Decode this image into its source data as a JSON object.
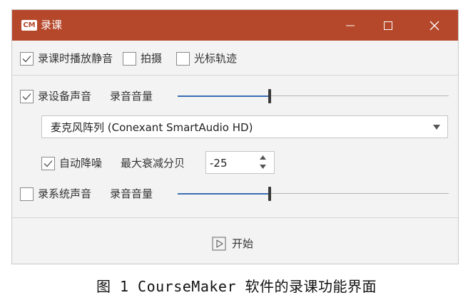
{
  "window": {
    "title": "录课",
    "logo_text": "CM",
    "accent_color": "#b5472a",
    "controls": [
      "minimize-icon",
      "maximize-icon",
      "close-icon"
    ]
  },
  "options": {
    "mute_playback": {
      "label": "录课时播放静音",
      "checked": true
    },
    "capture": {
      "label": "拍摄",
      "checked": false
    },
    "cursor_trail": {
      "label": "光标轨迹",
      "checked": false
    }
  },
  "device_audio": {
    "label": "录设备声音",
    "checked": true,
    "volume_label": "录音音量",
    "volume_fraction": 0.34,
    "device_selected": "麦克风阵列 (Conexant SmartAudio HD)",
    "noise_reduction": {
      "label": "自动降噪",
      "checked": true
    },
    "max_attenuation_label": "最大衰减分贝",
    "max_attenuation_value": "-25"
  },
  "system_audio": {
    "label": "录系统声音",
    "checked": false,
    "volume_label": "录音音量",
    "volume_fraction": 0.34
  },
  "footer": {
    "start_label": "开始"
  },
  "caption": "图 1  CourseMaker 软件的录课功能界面"
}
